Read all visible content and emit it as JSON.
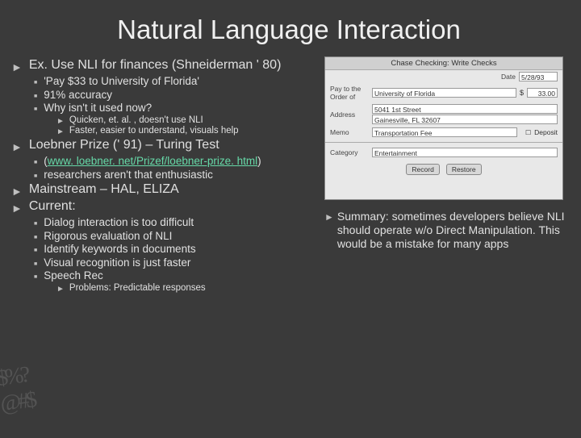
{
  "title": "Natural Language Interaction",
  "left": {
    "ex": {
      "heading": "Ex. Use NLI for finances (Shneiderman ' 80)",
      "items": [
        "'Pay $33 to University of Florida'",
        "91% accuracy",
        "Why isn't it used now?"
      ],
      "subitems": [
        "Quicken, et. al. , doesn't use NLI",
        "Faster, easier to understand, visuals help"
      ]
    },
    "loebner": {
      "heading": "Loebner Prize (' 91) – Turing Test",
      "link_pre": "(",
      "link_text": "www. loebner. net/Prizef/loebner-prize. html",
      "link_post": ")",
      "item2": "researchers aren't that enthusiastic"
    },
    "mainstream": "Mainstream – HAL, ELIZA",
    "current": {
      "heading": "Current:",
      "items": [
        "Dialog interaction is too difficult",
        "Rigorous evaluation of NLI",
        "Identify keywords in documents",
        "Visual recognition is just faster",
        "Speech Rec"
      ],
      "sub": "Problems: Predictable responses"
    }
  },
  "right": {
    "mock": {
      "title": "Chase Checking: Write Checks",
      "date_lbl": "Date",
      "date_val": "5/28/93",
      "payto_lbl": "Pay to the Order of",
      "payto_val": "University of Florida",
      "amount_val": "33.00",
      "addr_lbl": "Address",
      "addr_line1": "5041 1st Street",
      "addr_line2": "Gainesville, FL 32607",
      "memo_lbl": "Memo",
      "memo_val": "Transportation Fee",
      "cat_lbl": "Category",
      "cat_val": "Entertainment",
      "btn_record": "Record",
      "btn_restore": "Restore",
      "deposit": "Deposit"
    },
    "summary": "Summary: sometimes developers believe NLI should operate w/o Direct Manipulation.  This would be a mistake for many apps"
  },
  "deco": "$%?@#$"
}
